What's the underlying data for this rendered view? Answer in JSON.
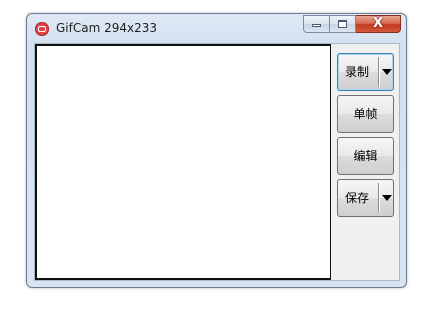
{
  "window": {
    "title": "GifCam 294x233",
    "app_icon": "gifcam-app-icon",
    "caption_buttons": {
      "minimize_icon": "minimize-icon",
      "maximize_icon": "maximize-icon",
      "close_glyph": "X"
    }
  },
  "buttons": {
    "record": {
      "label": "录制",
      "dropdown_icon": "dropdown-arrow-icon"
    },
    "single_frame": {
      "label": "单帧"
    },
    "edit": {
      "label": "编辑"
    },
    "save": {
      "label": "保存",
      "dropdown_icon": "dropdown-arrow-icon"
    }
  },
  "colors": {
    "focus_border": "#3c7fb1",
    "close_button": "#c2381c",
    "app_icon": "#e0424a"
  }
}
